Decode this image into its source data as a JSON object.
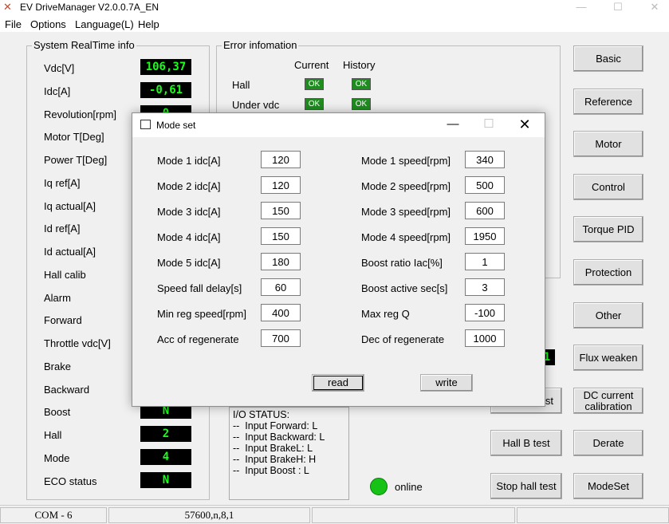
{
  "app": {
    "title": "EV DriveManager V2.0.0.7A_EN",
    "menu": [
      "File",
      "Options",
      "Language(L)",
      "Help"
    ]
  },
  "realtime": {
    "title": "System RealTime info",
    "rows": [
      {
        "label": "Vdc[V]",
        "value": "106,37"
      },
      {
        "label": "Idc[A]",
        "value": "-0,61"
      },
      {
        "label": "Revolution[rpm]",
        "value": "0"
      },
      {
        "label": "Motor T[Deg]",
        "value": ""
      },
      {
        "label": "Power T[Deg]",
        "value": ""
      },
      {
        "label": "Iq ref[A]",
        "value": ""
      },
      {
        "label": "Iq actual[A]",
        "value": ""
      },
      {
        "label": "Id ref[A]",
        "value": ""
      },
      {
        "label": "Id actual[A]",
        "value": ""
      },
      {
        "label": "Hall calib",
        "value": ""
      },
      {
        "label": "Alarm",
        "value": ""
      },
      {
        "label": "Forward",
        "value": ""
      },
      {
        "label": "Throttle vdc[V]",
        "value": ""
      },
      {
        "label": "Brake",
        "value": ""
      },
      {
        "label": "Backward",
        "value": ""
      },
      {
        "label": "Boost",
        "value": "N"
      },
      {
        "label": "Hall",
        "value": "2"
      },
      {
        "label": "Mode",
        "value": "4"
      },
      {
        "label": "ECO status",
        "value": "N"
      }
    ]
  },
  "errors": {
    "title": "Error infomation",
    "col_current": "Current",
    "col_history": "History",
    "rows": [
      {
        "label": "Hall",
        "current": "OK",
        "history": "OK"
      },
      {
        "label": "Under vdc",
        "current": "OK",
        "history": "OK"
      }
    ]
  },
  "side_buttons": [
    "Basic",
    "Reference",
    "Motor",
    "Control",
    "Torque PID",
    "Protection",
    "Other",
    "Flux weaken",
    "DC current calibration",
    "Derate",
    "ModeSet"
  ],
  "mid_buttons": {
    "partial": "st",
    "hall_b_test": "Hall B test",
    "stop_hall_test": "Stop hall test",
    "partial_lcd": "1"
  },
  "io_status": {
    "title": "I/O STATUS:",
    "lines": [
      "--  Input Forward: L",
      "--  Input Backward: L",
      "--  Input BrakeL: L",
      "--  Input BrakeH: H",
      "--  Input Boost : L"
    ]
  },
  "online_label": "online",
  "status_bar": {
    "port": "COM - 6",
    "settings": "57600,n,8,1"
  },
  "dialog": {
    "title": "Mode set",
    "left_fields": [
      {
        "label": "Mode 1 idc[A]",
        "value": "120"
      },
      {
        "label": "Mode 2 idc[A]",
        "value": "120"
      },
      {
        "label": "Mode 3 idc[A]",
        "value": "150"
      },
      {
        "label": "Mode 4 idc[A]",
        "value": "150"
      },
      {
        "label": "Mode 5 idc[A]",
        "value": "180"
      },
      {
        "label": "Speed fall delay[s]",
        "value": "60"
      },
      {
        "label": "Min reg speed[rpm]",
        "value": "400"
      },
      {
        "label": "Acc of regenerate",
        "value": "700"
      }
    ],
    "right_fields": [
      {
        "label": "Mode 1 speed[rpm]",
        "value": "340"
      },
      {
        "label": "Mode 2 speed[rpm]",
        "value": "500"
      },
      {
        "label": "Mode 3 speed[rpm]",
        "value": "600"
      },
      {
        "label": "Mode 4 speed[rpm]",
        "value": "1950"
      },
      {
        "label": "Boost ratio Iac[%]",
        "value": "1"
      },
      {
        "label": "Boost active sec[s]",
        "value": "3"
      },
      {
        "label": "Max reg Q",
        "value": "-100"
      },
      {
        "label": "Dec of regenerate",
        "value": "1000"
      }
    ],
    "read_label": "read",
    "write_label": "write"
  }
}
